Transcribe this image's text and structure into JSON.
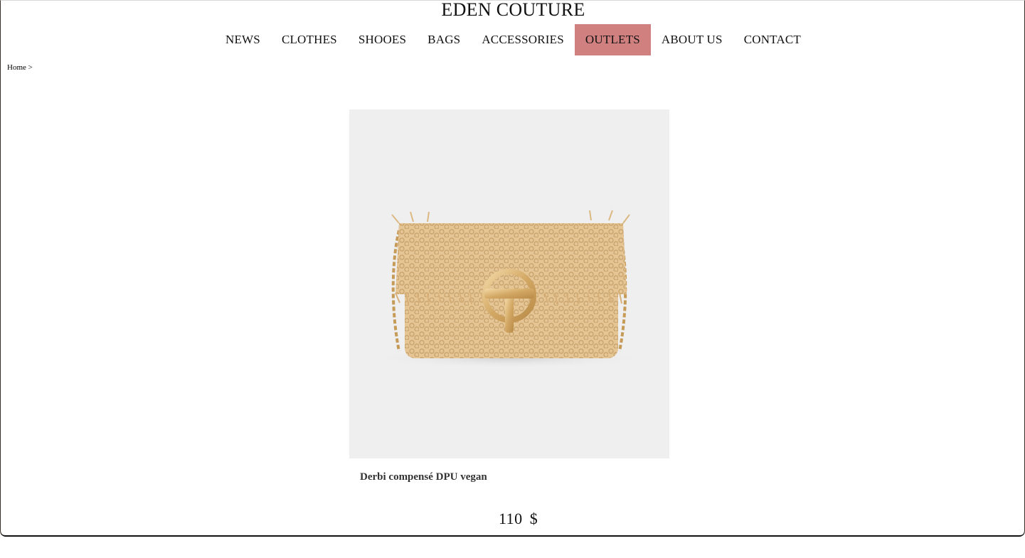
{
  "header": {
    "brand": "EDEN COUTURE"
  },
  "nav": {
    "items": [
      {
        "label": "NEWS",
        "active": false
      },
      {
        "label": "CLOTHES",
        "active": false
      },
      {
        "label": "SHOOES",
        "active": false
      },
      {
        "label": "BAGS",
        "active": false
      },
      {
        "label": "ACCESSORIES",
        "active": false
      },
      {
        "label": "OUTLETS",
        "active": true
      },
      {
        "label": "ABOUT US",
        "active": false
      },
      {
        "label": "CONTACT",
        "active": false
      }
    ],
    "active_color": "#d18080"
  },
  "breadcrumb": {
    "home": "Home",
    "separator": ">"
  },
  "product": {
    "image_icon": "raffia-crochet-bag-image",
    "name": "Derbi compensé DPU vegan",
    "price": "110",
    "currency": "$"
  }
}
